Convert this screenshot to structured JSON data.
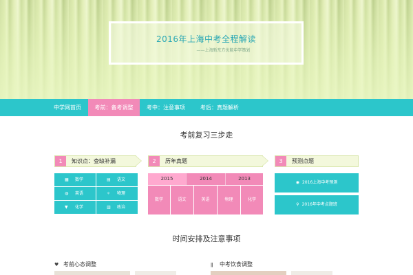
{
  "banner": {
    "title": "2016年上海中考全程解读",
    "subtitle": "——上海新东方优能中学策划"
  },
  "nav": {
    "items": [
      {
        "label": "中学网首页",
        "active": false
      },
      {
        "label": "考前：备考调整",
        "active": true
      },
      {
        "label": "考中：注意事项",
        "active": false
      },
      {
        "label": "考后：真题解析",
        "active": false
      }
    ]
  },
  "sections": {
    "steps_title": "考前复习三步走",
    "schedule_title": "时间安排及注意事项"
  },
  "steps": [
    {
      "num": "1",
      "label": "知识点：查缺补漏"
    },
    {
      "num": "2",
      "label": "历年真题"
    },
    {
      "num": "3",
      "label": "预测点题"
    }
  ],
  "subjects": [
    {
      "label": "数学",
      "icon": "calculator-icon",
      "glyph": "▦"
    },
    {
      "label": "语文",
      "icon": "book-icon",
      "glyph": "▤"
    },
    {
      "label": "英语",
      "icon": "globe-icon",
      "glyph": "◍"
    },
    {
      "label": "物理",
      "icon": "magnet-icon",
      "glyph": "✧"
    },
    {
      "label": "化学",
      "icon": "flask-icon",
      "glyph": "▼"
    },
    {
      "label": "政治",
      "icon": "bank-icon",
      "glyph": "▥"
    }
  ],
  "exam_years": [
    {
      "label": "2015",
      "active": true
    },
    {
      "label": "2014",
      "active": false
    },
    {
      "label": "2013",
      "active": false
    }
  ],
  "exam_subjects": [
    "数学",
    "语文",
    "英语",
    "物理",
    "化学"
  ],
  "predictions": [
    {
      "label": "2016上海中考预测",
      "icon": "eye-icon",
      "glyph": "◉"
    },
    {
      "label": "2016年中考点题班",
      "icon": "map-pin-icon",
      "glyph": "⚲"
    }
  ],
  "tips": [
    {
      "label": "考前心态调整",
      "icon": "heart-icon",
      "glyph": "♥"
    },
    {
      "label": "中考饮食调整",
      "icon": "restaurant-icon",
      "glyph": "ǁ"
    }
  ],
  "colors": {
    "accent_teal": "#2cc6cb",
    "accent_pink": "#f28ab8",
    "step_bg": "#f3f8dc"
  }
}
